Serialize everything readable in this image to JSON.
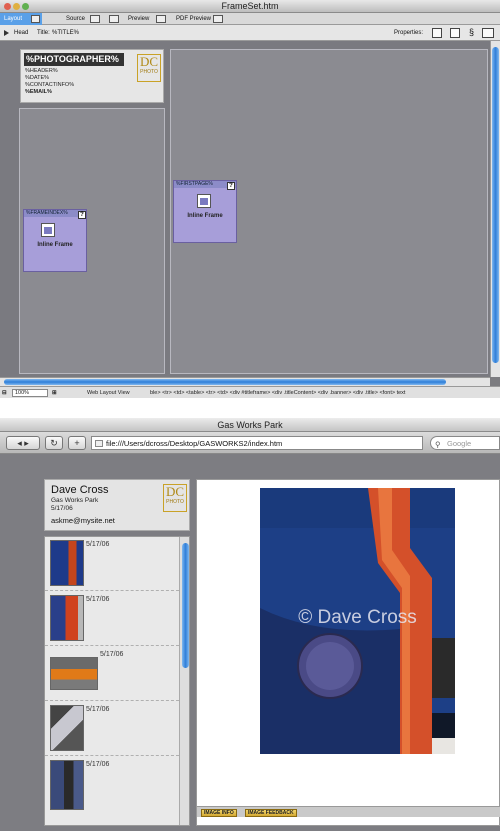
{
  "editor": {
    "window_title": "FrameSet.htm",
    "toolbar": {
      "layout": "Layout",
      "source": "Source",
      "preview": "Preview",
      "pdf_preview": "PDF Preview"
    },
    "head": {
      "head_label": "Head",
      "title_label": "Title:",
      "title_value": "%TITLE%",
      "properties_label": "Properties:"
    },
    "header_frame": {
      "photographer": "%PHOTOGRAPHER%",
      "lines": [
        "%HEADER%",
        "%DATE%",
        "%CONTACTINFO%",
        "%EMAIL%"
      ],
      "logo_text": "PHOTO"
    },
    "left_iframe": {
      "tag": "%FRAMEINDEX%",
      "label": "Inline Frame",
      "q": "?"
    },
    "right_iframe": {
      "tag": "%FIRSTPAGE%",
      "label": "Inline Frame",
      "q": "?"
    },
    "status": {
      "zoom": "100%",
      "view": "Web Layout View",
      "path": "ble>  <tr>  <td>  <table>  <tr>  <td>  <div #titleframe>  <div .titleContent>  <div .banner>  <div .title>  <font>  text"
    }
  },
  "browser": {
    "window_title": "Gas Works Park",
    "url": "file:///Users/dcross/Desktop/GASWORKS2/index.htm",
    "search_placeholder": "Google",
    "header": {
      "name": "Dave Cross",
      "subtitle": "Gas Works Park",
      "date": "5/17/06",
      "email": "askme@mysite.net",
      "logo_text": "PHOTO"
    },
    "thumbs": [
      {
        "date": "5/17/06"
      },
      {
        "date": "5/17/06"
      },
      {
        "date": "5/17/06"
      },
      {
        "date": "5/17/06"
      },
      {
        "date": "5/17/06"
      }
    ],
    "watermark": "© Dave Cross",
    "tabs": [
      "IMAGE INFO",
      "IMAGE FEEDBACK"
    ]
  }
}
